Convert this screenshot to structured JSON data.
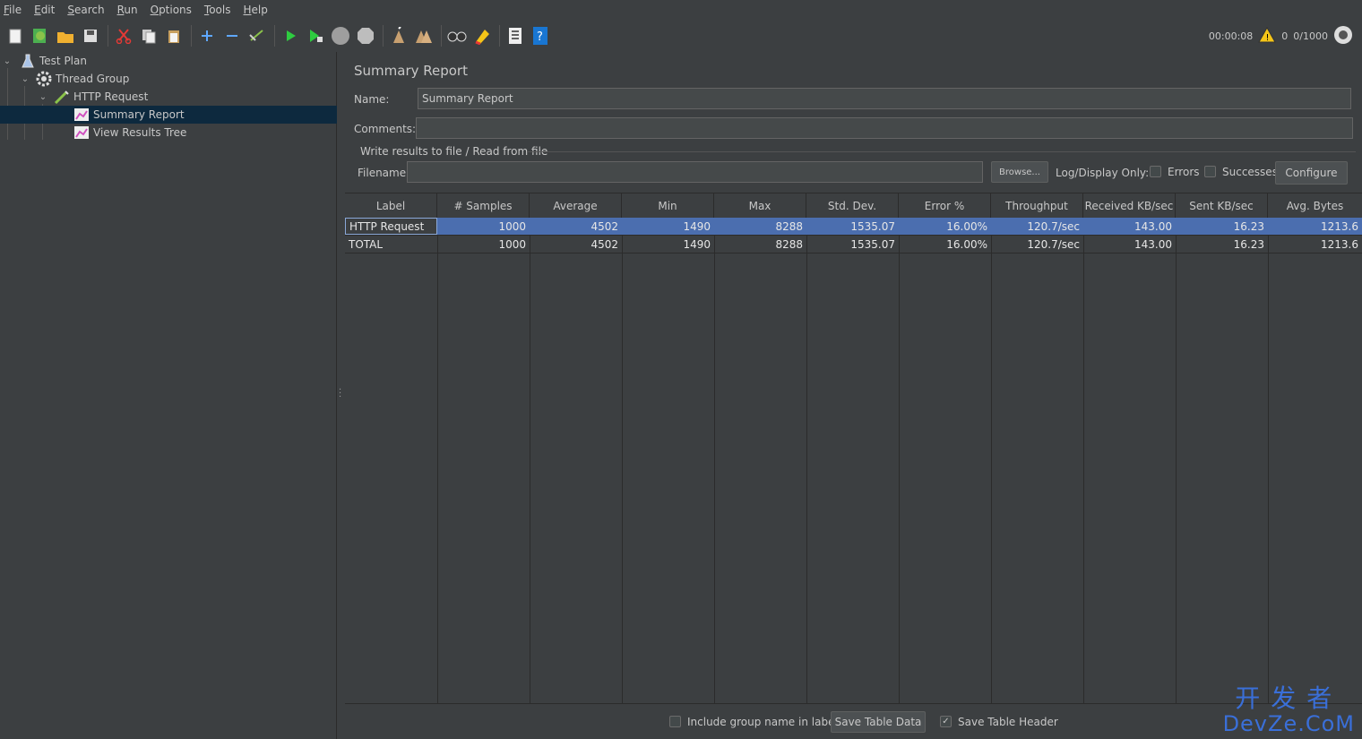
{
  "menu": [
    "File",
    "Edit",
    "Search",
    "Run",
    "Options",
    "Tools",
    "Help"
  ],
  "toolbar": {
    "icons": [
      "new-icon",
      "templates-icon",
      "open-icon",
      "save-icon",
      "cut-icon",
      "copy-icon",
      "paste-icon",
      "expand-icon",
      "collapse-icon",
      "toggle-icon",
      "start-icon",
      "start-no-pause-icon",
      "stop-icon",
      "shutdown-icon",
      "clear-icon",
      "clear-all-icon",
      "search-icon",
      "reset-search-icon",
      "function-helper-icon",
      "help-icon"
    ],
    "elapsed": "00:00:08",
    "warnings": "0",
    "threads": "0/1000"
  },
  "tree": {
    "items": [
      {
        "label": "Test Plan"
      },
      {
        "label": "Thread Group"
      },
      {
        "label": "HTTP Request"
      },
      {
        "label": "Summary Report"
      },
      {
        "label": "View Results Tree"
      }
    ]
  },
  "panel": {
    "title": "Summary Report",
    "name_label": "Name:",
    "name_value": "Summary Report",
    "comments_label": "Comments:",
    "comments_value": "",
    "file_group_label": "Write results to file / Read from file",
    "filename_label": "Filename",
    "filename_value": "",
    "browse_label": "Browse...",
    "log_display_label": "Log/Display Only:",
    "errors_label": "Errors",
    "successes_label": "Successes",
    "configure_label": "Configure"
  },
  "table": {
    "headers": [
      "Label",
      "# Samples",
      "Average",
      "Min",
      "Max",
      "Std. Dev.",
      "Error %",
      "Throughput",
      "Received KB/sec",
      "Sent KB/sec",
      "Avg. Bytes"
    ],
    "rows": [
      [
        "HTTP Request",
        "1000",
        "4502",
        "1490",
        "8288",
        "1535.07",
        "16.00%",
        "120.7/sec",
        "143.00",
        "16.23",
        "1213.6"
      ],
      [
        "TOTAL",
        "1000",
        "4502",
        "1490",
        "8288",
        "1535.07",
        "16.00%",
        "120.7/sec",
        "143.00",
        "16.23",
        "1213.6"
      ]
    ]
  },
  "footer": {
    "include_group_label": "Include group name in label?",
    "include_group_checked": false,
    "save_table_data_label": "Save Table Data",
    "save_table_header_label": "Save Table Header",
    "save_table_header_checked": true
  },
  "watermark": {
    "cn": "开发者",
    "en": "DevZe.CoM"
  }
}
